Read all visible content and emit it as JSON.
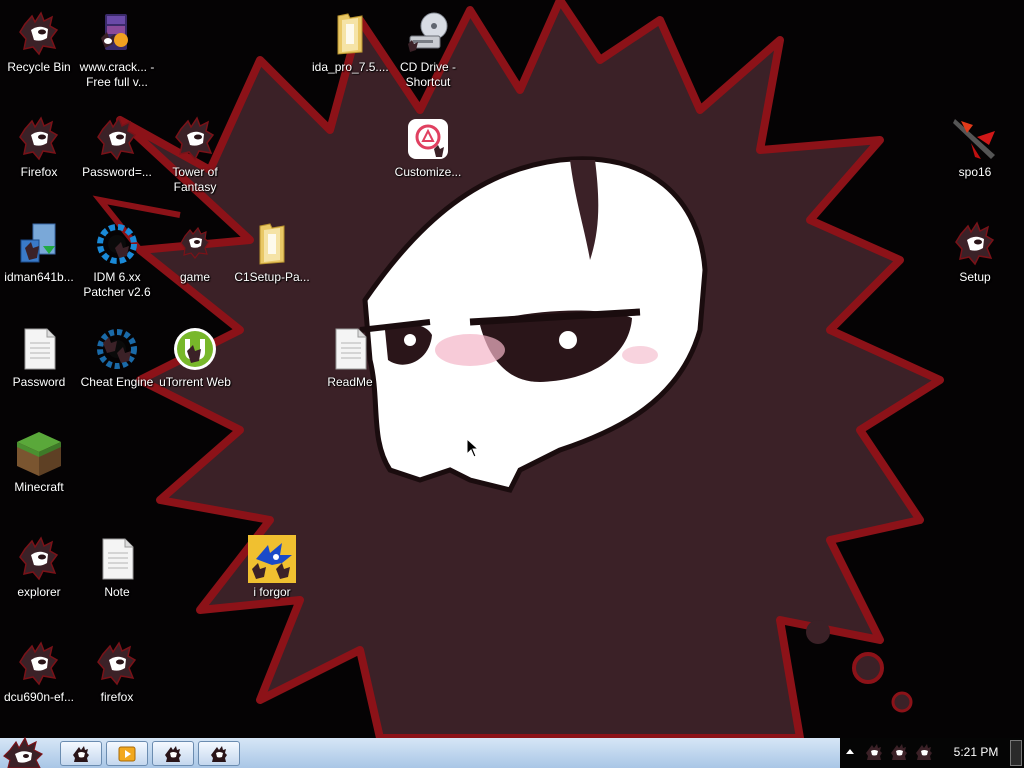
{
  "desktop": {
    "icons": [
      {
        "id": "recycle-bin",
        "label": "Recycle Bin",
        "icon": "mascot-icon"
      },
      {
        "id": "www-crack",
        "label": "www.crack... - Free full v...",
        "icon": "winrar-icon"
      },
      {
        "id": "ida-pro",
        "label": "ida_pro_7.5....",
        "icon": "folder-icon"
      },
      {
        "id": "cd-drive",
        "label": "CD Drive - Shortcut",
        "icon": "cd-drive-icon"
      },
      {
        "id": "firefox",
        "label": "Firefox",
        "icon": "mascot-icon"
      },
      {
        "id": "password-eq",
        "label": "Password=...",
        "icon": "mascot-icon"
      },
      {
        "id": "tower-of-fantasy",
        "label": "Tower of Fantasy",
        "icon": "mascot-icon"
      },
      {
        "id": "customize",
        "label": "Customize...",
        "icon": "customize-icon"
      },
      {
        "id": "spo16",
        "label": "spo16",
        "icon": "weapon-icon"
      },
      {
        "id": "idman",
        "label": "idman641b...",
        "icon": "installer-icon"
      },
      {
        "id": "idm-patcher",
        "label": "IDM 6.xx Patcher v2.6",
        "icon": "gear-icon"
      },
      {
        "id": "game",
        "label": "game",
        "icon": "mascot-icon"
      },
      {
        "id": "c1setup",
        "label": "C1Setup-Pa...",
        "icon": "folder-icon"
      },
      {
        "id": "setup",
        "label": "Setup",
        "icon": "mascot-icon"
      },
      {
        "id": "password",
        "label": "Password",
        "icon": "text-file-icon"
      },
      {
        "id": "cheat-engine",
        "label": "Cheat Engine",
        "icon": "gear-icon"
      },
      {
        "id": "utorrent-web",
        "label": "uTorrent Web",
        "icon": "utorrent-icon"
      },
      {
        "id": "readme",
        "label": "ReadMe",
        "icon": "text-file-icon"
      },
      {
        "id": "minecraft",
        "label": "Minecraft",
        "icon": "grass-block-icon"
      },
      {
        "id": "explorer",
        "label": "explorer",
        "icon": "mascot-icon"
      },
      {
        "id": "note",
        "label": "Note",
        "icon": "text-file-icon"
      },
      {
        "id": "i-forgor",
        "label": "i forgor",
        "icon": "sonic-icon"
      },
      {
        "id": "dcu690n",
        "label": "dcu690n-ef...",
        "icon": "mascot-icon"
      },
      {
        "id": "firefox-lower",
        "label": "firefox",
        "icon": "mascot-icon"
      }
    ]
  },
  "taskbar": {
    "start_icon": "mascot-icon",
    "buttons": [
      {
        "id": "task-1",
        "icon": "mascot-icon"
      },
      {
        "id": "task-2",
        "icon": "media-player-icon"
      },
      {
        "id": "task-3",
        "icon": "mascot-icon"
      },
      {
        "id": "task-4",
        "icon": "mascot-icon"
      }
    ],
    "tray_icons": [
      "mascot-icon",
      "mascot-icon",
      "mascot-icon"
    ],
    "clock": "5:21 PM"
  },
  "colors": {
    "wallpaper_bg": "#050304",
    "mascot_body": "#3a2026",
    "mascot_outline": "#8c1218",
    "taskbar_light": "#c4d7ee"
  }
}
